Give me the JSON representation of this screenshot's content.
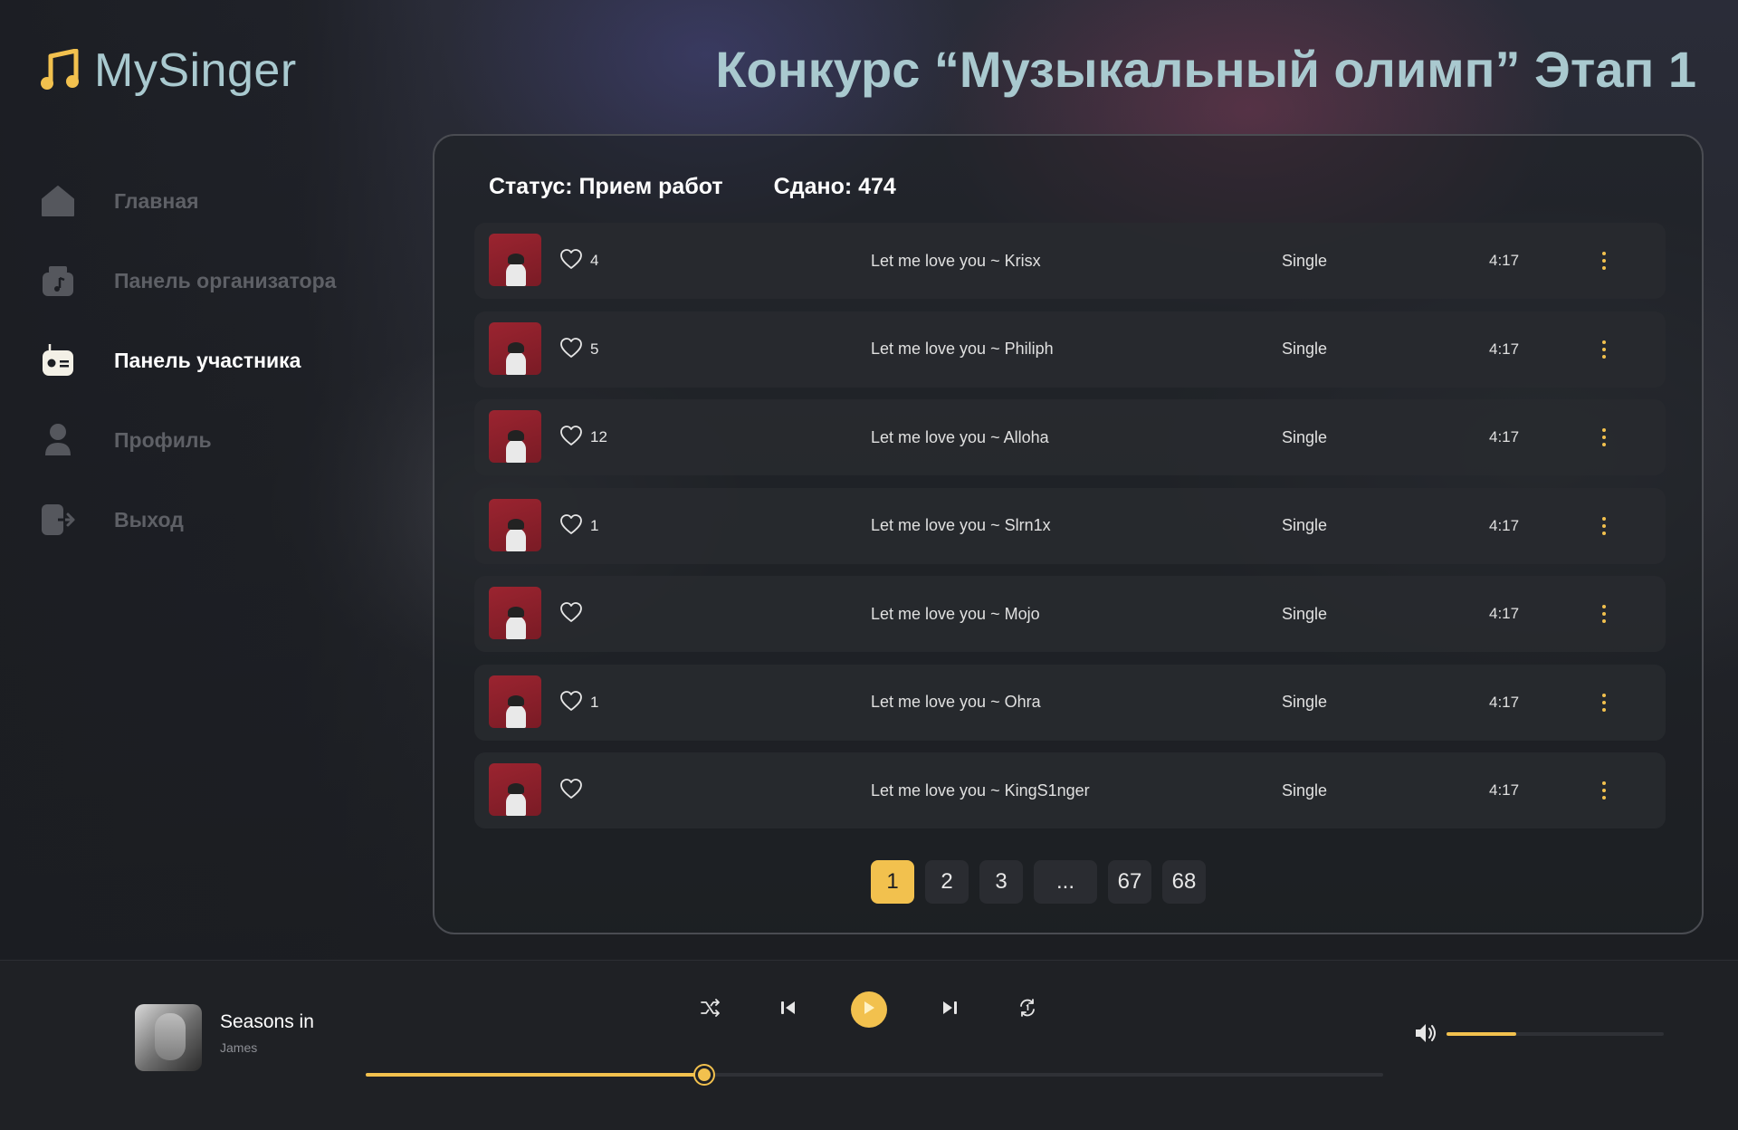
{
  "app": {
    "name": "MySinger"
  },
  "page": {
    "title": "Конкурс “Музыкальный олимп” Этап 1"
  },
  "sidebar": {
    "items": [
      {
        "label": "Главная",
        "icon": "home-icon",
        "active": false
      },
      {
        "label": "Панель организатора",
        "icon": "organizer-icon",
        "active": false
      },
      {
        "label": "Панель участника",
        "icon": "radio-icon",
        "active": true
      },
      {
        "label": "Профиль",
        "icon": "user-icon",
        "active": false
      },
      {
        "label": "Выход",
        "icon": "logout-icon",
        "active": false
      }
    ]
  },
  "status": {
    "status_text": "Статус: Прием работ",
    "submitted_text": "Сдано: 474"
  },
  "tracks": [
    {
      "likes": "4",
      "title": "Let me love you ~ Krisx",
      "type": "Single",
      "duration": "4:17"
    },
    {
      "likes": "5",
      "title": "Let me love you ~ Philiph",
      "type": "Single",
      "duration": "4:17"
    },
    {
      "likes": "12",
      "title": "Let me love you ~ Alloha",
      "type": "Single",
      "duration": "4:17"
    },
    {
      "likes": "1",
      "title": "Let me love you ~ Slrn1x",
      "type": "Single",
      "duration": "4:17"
    },
    {
      "likes": "",
      "title": "Let me love you ~ Mojo",
      "type": "Single",
      "duration": "4:17"
    },
    {
      "likes": "1",
      "title": "Let me love you ~ Ohra",
      "type": "Single",
      "duration": "4:17"
    },
    {
      "likes": "",
      "title": "Let me love you ~ KingS1nger",
      "type": "Single",
      "duration": "4:17"
    }
  ],
  "pagination": {
    "pages": [
      "1",
      "2",
      "3",
      "...",
      "67",
      "68"
    ],
    "current": "1"
  },
  "player": {
    "title": "Seasons in",
    "artist": "James",
    "progress": 0.333,
    "volume": 0.32
  },
  "colors": {
    "accent": "#f2c14e",
    "title": "#a9c9cf",
    "background": "#1b1d22"
  }
}
